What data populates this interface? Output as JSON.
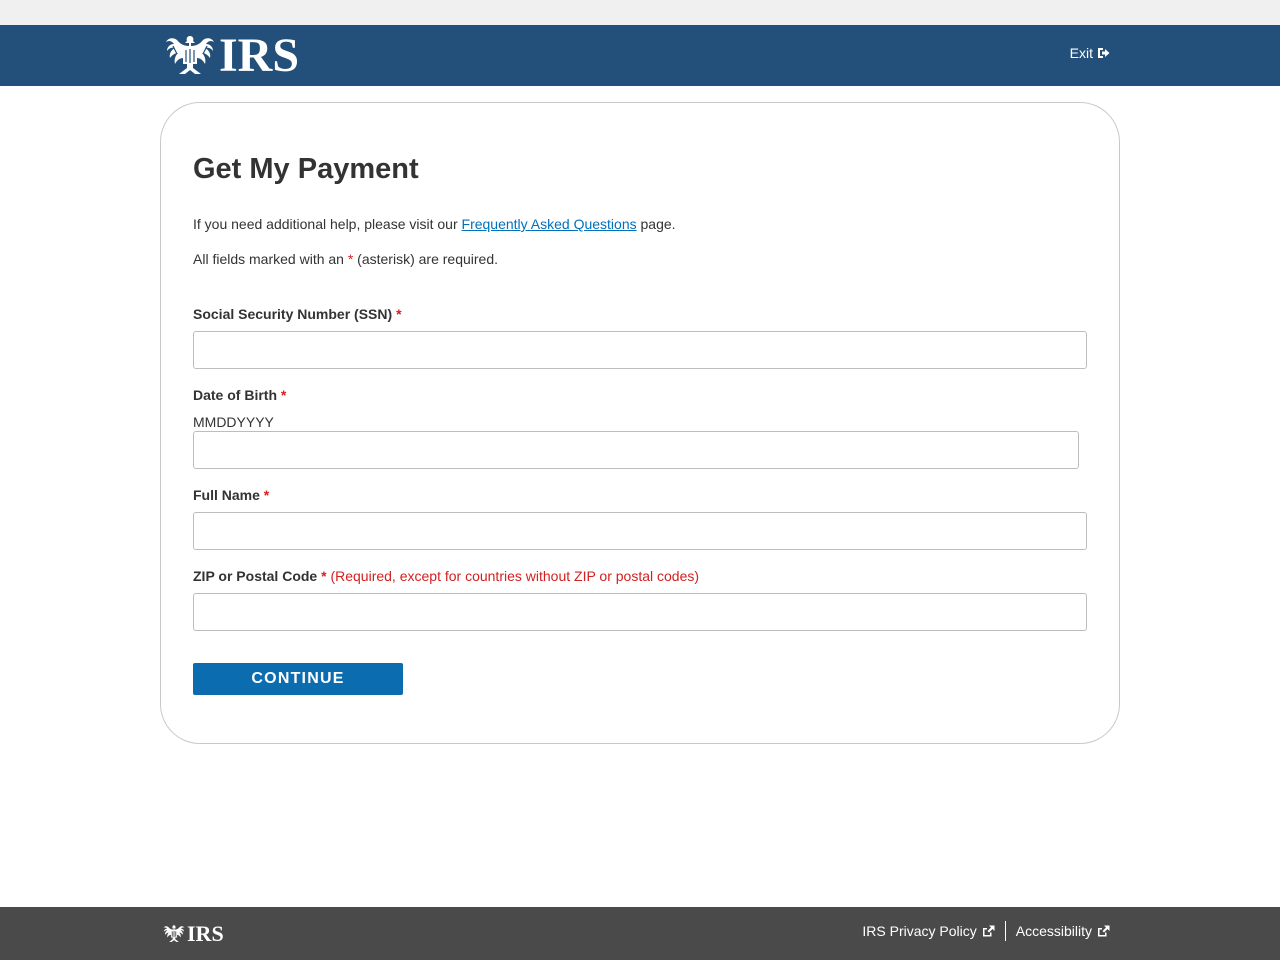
{
  "header": {
    "logo_text": "IRS",
    "exit_label": "Exit"
  },
  "form": {
    "title": "Get My Payment",
    "help_prefix": "If you need additional help, please visit our ",
    "help_link": "Frequently Asked Questions",
    "help_suffix": " page.",
    "required_prefix": "All fields marked with an ",
    "required_star": "*",
    "required_suffix": " (asterisk) are required.",
    "fields": [
      {
        "label": "Social Security Number (SSN)",
        "star": "*",
        "value": ""
      },
      {
        "label": "Date of Birth",
        "star": "*",
        "hint": "MMDDYYYY",
        "value": ""
      },
      {
        "label": "Full Name",
        "star": "*",
        "value": ""
      },
      {
        "label": "ZIP or Postal Code",
        "star": "*",
        "note": "(Required, except for countries without ZIP or postal codes)",
        "value": ""
      }
    ],
    "continue_label": "CONTINUE"
  },
  "footer": {
    "logo_text": "IRS",
    "links": [
      "IRS Privacy Policy",
      "Accessibility"
    ]
  },
  "colors": {
    "header_bg": "#23507a",
    "button_bg": "#0b6db0",
    "link": "#0071bc",
    "required": "#d42020",
    "footer_bg": "#4a4a4a"
  },
  "icons": {
    "logo": "irs-eagle-icon",
    "exit": "sign-out-icon",
    "external": "external-link-icon"
  }
}
